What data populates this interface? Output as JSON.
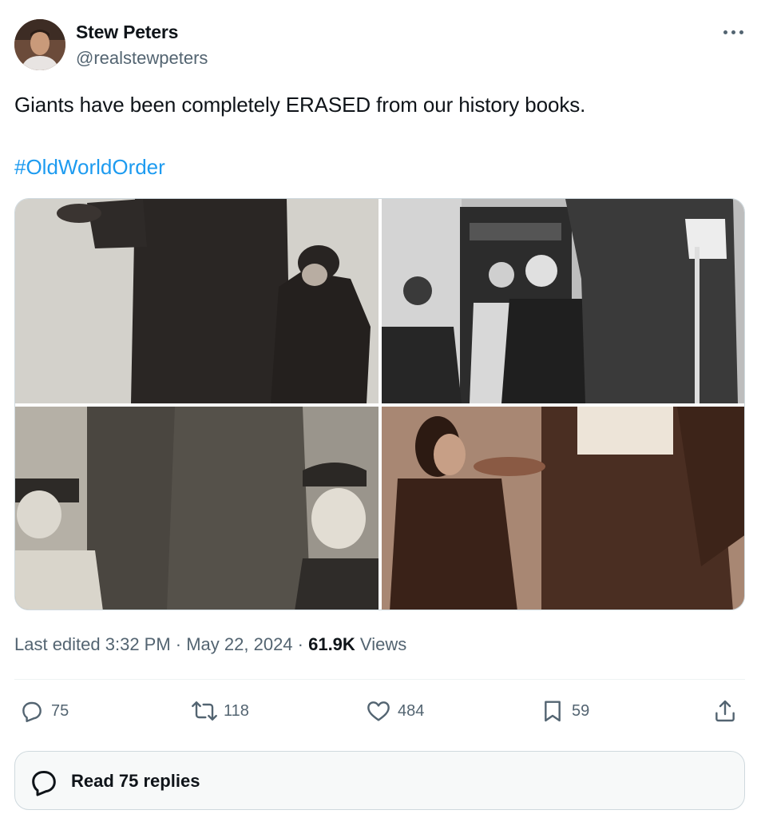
{
  "author": {
    "name": "Stew Peters",
    "handle": "@realstewpeters"
  },
  "tweet": {
    "text": "Giants have been completely ERASED from our history books.",
    "hashtag": "#OldWorldOrder"
  },
  "meta": {
    "edited": "Last edited 3:32 PM · May 22, 2024 · ",
    "views_count": "61.9K",
    "views_label": " Views"
  },
  "actions": {
    "replies": "75",
    "reposts": "118",
    "likes": "484",
    "bookmarks": "59"
  },
  "replies_button": {
    "label": "Read 75 replies"
  },
  "colors": {
    "link": "#1d9bf0",
    "secondary_text": "#536471",
    "primary_text": "#0f1419"
  }
}
